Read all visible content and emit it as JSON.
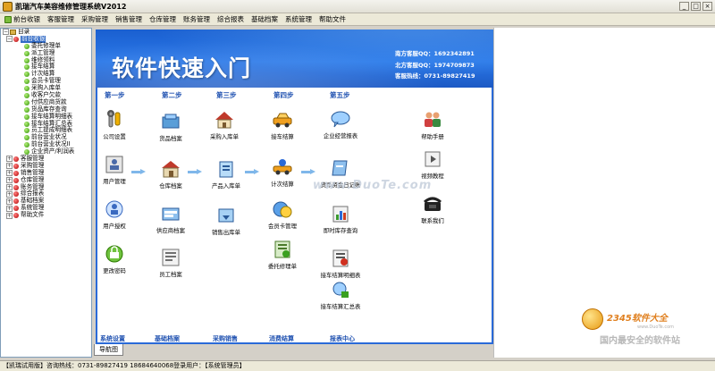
{
  "window": {
    "title": "凯瑞汽车美容维修管理系统V2012",
    "buttons": [
      "_",
      "□",
      "×"
    ]
  },
  "menubar": [
    "前台收银",
    "客服管理",
    "采购管理",
    "销售管理",
    "仓库管理",
    "账务管理",
    "综合报表",
    "基础档案",
    "系统管理",
    "帮助文件"
  ],
  "sidebar": {
    "root": "目录",
    "items": [
      {
        "label": "前台收银",
        "expanded": true,
        "selected": true,
        "children": [
          "委托修理单",
          "派工管理",
          "维修领料",
          "接车结算",
          "计次结算",
          "会员卡管理",
          "采购入库单",
          "收客户欠款",
          "付供应商货款",
          "货品库存查询",
          "接车结算明细表",
          "接车结算汇总表",
          "员工提成明细表",
          "前台营业状况",
          "前台营业状况II",
          "企业资产/利润表"
        ]
      },
      {
        "label": "客服管理"
      },
      {
        "label": "采购管理"
      },
      {
        "label": "销售管理"
      },
      {
        "label": "仓库管理"
      },
      {
        "label": "账务管理"
      },
      {
        "label": "综合报表"
      },
      {
        "label": "基础档案"
      },
      {
        "label": "系统管理"
      },
      {
        "label": "帮助文件"
      }
    ]
  },
  "banner": {
    "title": "软件快速入门",
    "contacts": [
      "南方客服QQ：1692342891",
      "北方客服QQ：1974709873",
      "客服热线：0731-89827419"
    ]
  },
  "steps": [
    "第一步",
    "第二步",
    "第三步",
    "第四步",
    "第五步"
  ],
  "icons": {
    "company_setup": "公司设置",
    "goods_archive": "货品档案",
    "purchase_in": "采购入库单",
    "car_settle": "接车结算",
    "business_report": "企业经营报表",
    "help_manual": "帮助手册",
    "user_manage": "用户管理",
    "warehouse_archive": "仓库档案",
    "product_in": "产品入库单",
    "count_settle": "计次结算",
    "cashflow_log": "货币资金日记账",
    "video_tutorial": "视频教程",
    "user_auth": "用户授权",
    "supplier_archive": "供应商档案",
    "sales_out": "销售出库单",
    "member_card": "会员卡管理",
    "stock_query": "即时库存查询",
    "contact_us": "联系我们",
    "change_password": "更改密码",
    "employee_archive": "员工档案",
    "repair_order": "委托修理单",
    "settle_detail": "接车结算明细表",
    "settle_summary": "接车结算汇总表"
  },
  "sections": [
    "系统设置",
    "基础档案",
    "采购销售",
    "消费结算",
    "报表中心"
  ],
  "watermark": "www.DuoTe.com",
  "corner_logo": {
    "brand": "2345软件大全",
    "slogan": "国内最安全的软件站",
    "url": "www.DuoTe.com"
  },
  "tab": "导航图",
  "status": "【凯瑞试用版】咨询热线：0731-89827419 18684640068登录用户：【系统管理员】"
}
